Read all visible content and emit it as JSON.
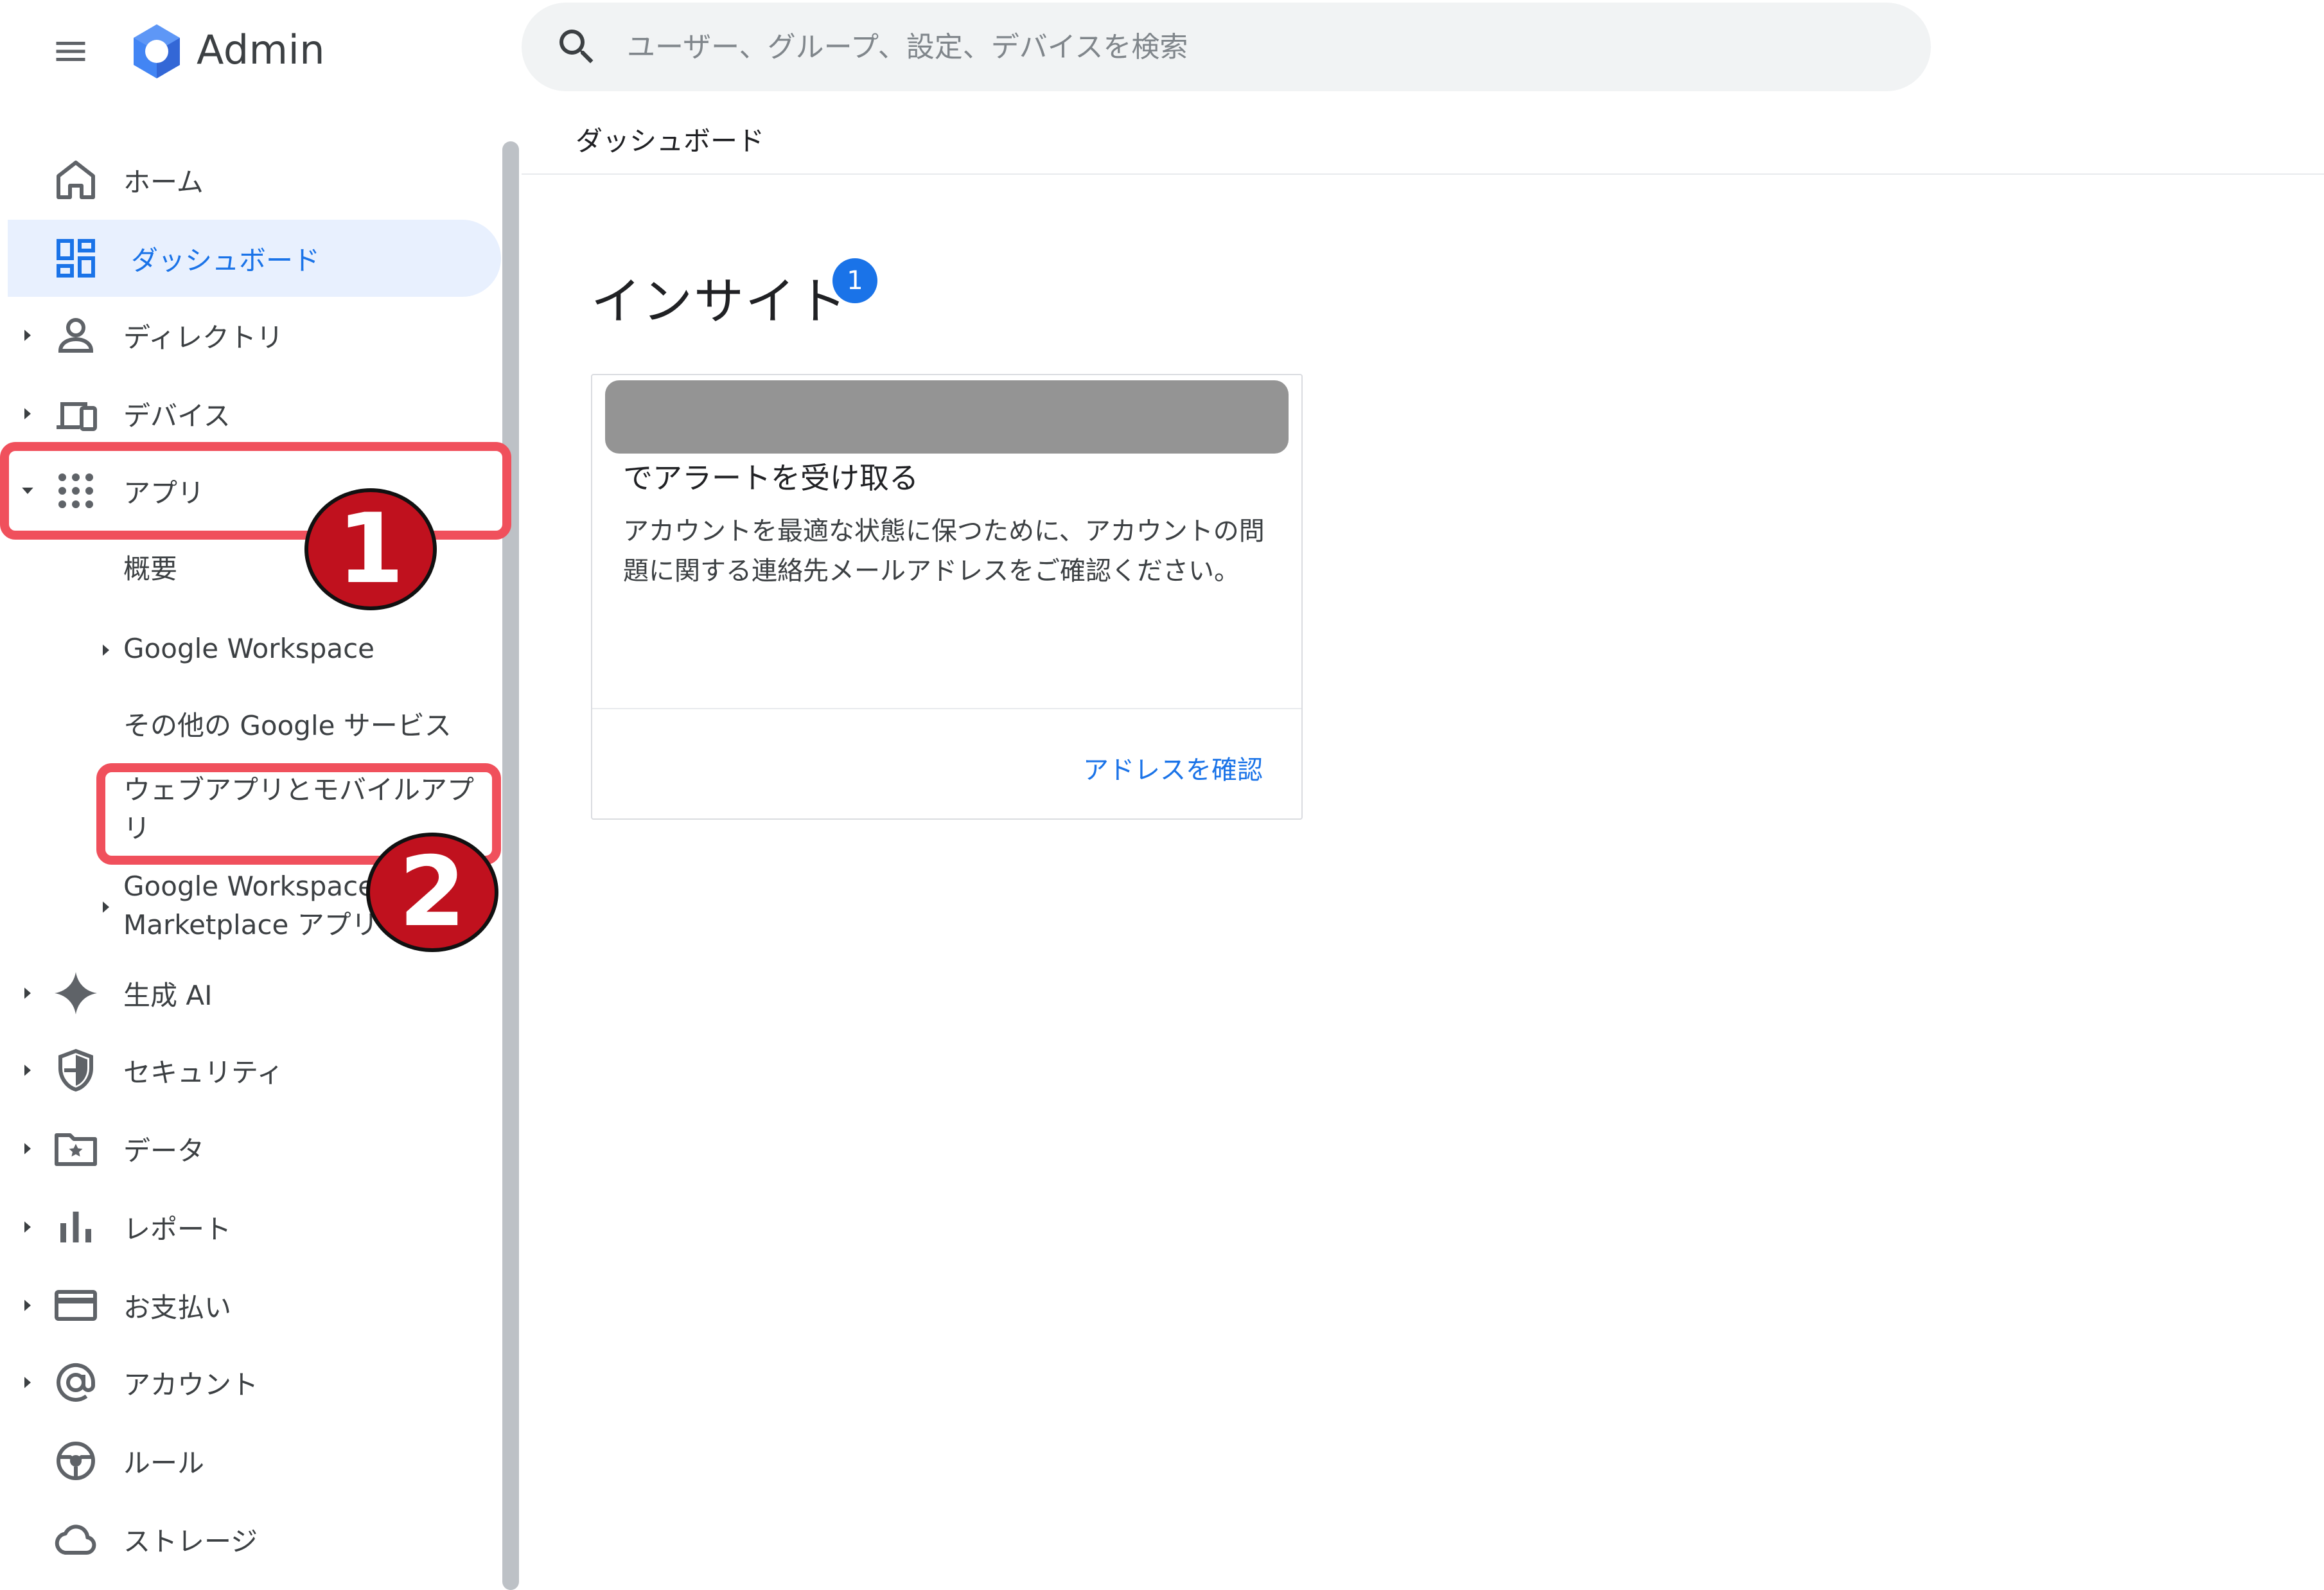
{
  "header": {
    "app_title": "Admin",
    "search_placeholder": "ユーザー、グループ、設定、デバイスを検索"
  },
  "breadcrumb": "ダッシュボード",
  "sidebar": {
    "items": [
      {
        "label": "ホーム",
        "icon": "home-icon"
      },
      {
        "label": "ダッシュボード",
        "icon": "dashboard-icon",
        "active": true
      },
      {
        "label": "ディレクトリ",
        "icon": "person-icon"
      },
      {
        "label": "デバイス",
        "icon": "devices-icon"
      },
      {
        "label": "アプリ",
        "icon": "apps-grid-icon",
        "expanded": true
      },
      {
        "label": "生成 AI",
        "icon": "sparkle-icon"
      },
      {
        "label": "セキュリティ",
        "icon": "shield-icon"
      },
      {
        "label": "データ",
        "icon": "folder-star-icon"
      },
      {
        "label": "レポート",
        "icon": "bar-chart-icon"
      },
      {
        "label": "お支払い",
        "icon": "credit-card-icon"
      },
      {
        "label": "アカウント",
        "icon": "at-sign-icon"
      },
      {
        "label": "ルール",
        "icon": "rules-icon"
      },
      {
        "label": "ストレージ",
        "icon": "cloud-icon"
      }
    ],
    "apps_subitems": [
      {
        "label": "概要"
      },
      {
        "label": "Google Workspace"
      },
      {
        "label": "その他の Google サービス"
      },
      {
        "label": "ウェブアプリとモバイルアプリ"
      },
      {
        "label": "Google Workspace Marketplace アプリ"
      }
    ]
  },
  "annotations": {
    "step1": "1",
    "step2": "2"
  },
  "main": {
    "insight_title": "インサイト",
    "insight_count": "1",
    "card": {
      "title": "でアラートを受け取る",
      "body": "アカウントを最適な状態に保つために、アカウントの問題に関する連絡先メールアドレスをご確認ください。",
      "action": "アドレスを確認"
    }
  },
  "colors": {
    "accent": "#1a73e8",
    "active_bg": "#e8f0fe",
    "annotation_box": "#f0505c",
    "annotation_circle": "#c0111e",
    "redacted": "#949494"
  }
}
